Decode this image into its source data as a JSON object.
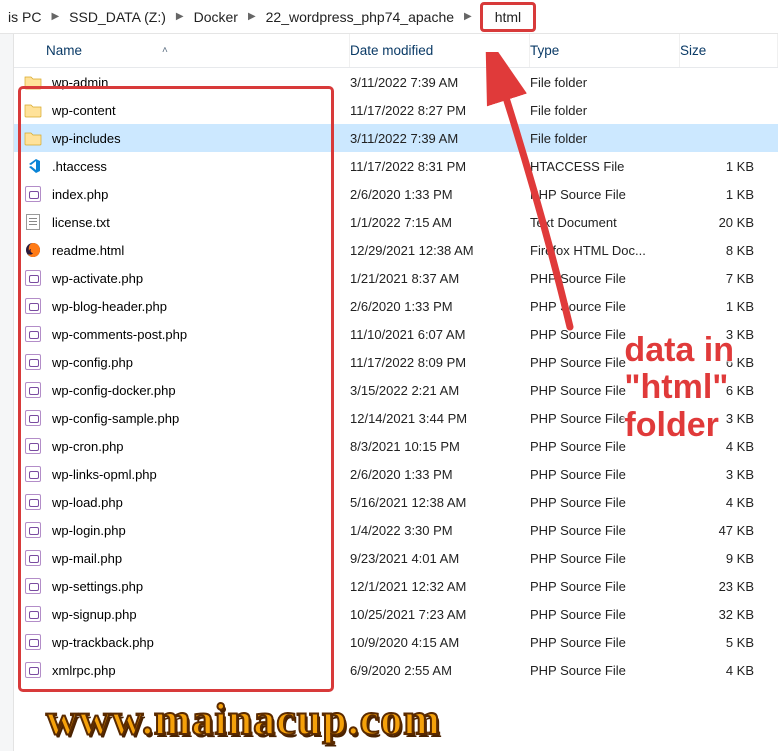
{
  "breadcrumb": {
    "items": [
      "is PC",
      "SSD_DATA (Z:)",
      "Docker",
      "22_wordpress_php74_apache",
      "html"
    ],
    "highlighted": "html"
  },
  "columns": {
    "name": "Name",
    "date": "Date modified",
    "type": "Type",
    "size": "Size"
  },
  "annotation": {
    "text": "data in\n\"html\"\nfolder"
  },
  "watermark": "www.mainacup.com",
  "files": [
    {
      "icon": "folder",
      "name": "wp-admin",
      "date": "3/11/2022 7:39 AM",
      "type": "File folder",
      "size": ""
    },
    {
      "icon": "folder",
      "name": "wp-content",
      "date": "11/17/2022 8:27 PM",
      "type": "File folder",
      "size": ""
    },
    {
      "icon": "folder",
      "name": "wp-includes",
      "date": "3/11/2022 7:39 AM",
      "type": "File folder",
      "size": "",
      "selected": true
    },
    {
      "icon": "vs",
      "name": ".htaccess",
      "date": "11/17/2022 8:31 PM",
      "type": "HTACCESS File",
      "size": "1 KB"
    },
    {
      "icon": "php",
      "name": "index.php",
      "date": "2/6/2020 1:33 PM",
      "type": "PHP Source File",
      "size": "1 KB"
    },
    {
      "icon": "txt",
      "name": "license.txt",
      "date": "1/1/2022 7:15 AM",
      "type": "Text Document",
      "size": "20 KB"
    },
    {
      "icon": "ff",
      "name": "readme.html",
      "date": "12/29/2021 12:38 AM",
      "type": "Firefox HTML Doc...",
      "size": "8 KB"
    },
    {
      "icon": "php",
      "name": "wp-activate.php",
      "date": "1/21/2021 8:37 AM",
      "type": "PHP Source File",
      "size": "7 KB"
    },
    {
      "icon": "php",
      "name": "wp-blog-header.php",
      "date": "2/6/2020 1:33 PM",
      "type": "PHP Source File",
      "size": "1 KB"
    },
    {
      "icon": "php",
      "name": "wp-comments-post.php",
      "date": "11/10/2021 6:07 AM",
      "type": "PHP Source File",
      "size": "3 KB"
    },
    {
      "icon": "php",
      "name": "wp-config.php",
      "date": "11/17/2022 8:09 PM",
      "type": "PHP Source File",
      "size": "6 KB"
    },
    {
      "icon": "php",
      "name": "wp-config-docker.php",
      "date": "3/15/2022 2:21 AM",
      "type": "PHP Source File",
      "size": "6 KB"
    },
    {
      "icon": "php",
      "name": "wp-config-sample.php",
      "date": "12/14/2021 3:44 PM",
      "type": "PHP Source File",
      "size": "3 KB"
    },
    {
      "icon": "php",
      "name": "wp-cron.php",
      "date": "8/3/2021 10:15 PM",
      "type": "PHP Source File",
      "size": "4 KB"
    },
    {
      "icon": "php",
      "name": "wp-links-opml.php",
      "date": "2/6/2020 1:33 PM",
      "type": "PHP Source File",
      "size": "3 KB"
    },
    {
      "icon": "php",
      "name": "wp-load.php",
      "date": "5/16/2021 12:38 AM",
      "type": "PHP Source File",
      "size": "4 KB"
    },
    {
      "icon": "php",
      "name": "wp-login.php",
      "date": "1/4/2022 3:30 PM",
      "type": "PHP Source File",
      "size": "47 KB"
    },
    {
      "icon": "php",
      "name": "wp-mail.php",
      "date": "9/23/2021 4:01 AM",
      "type": "PHP Source File",
      "size": "9 KB"
    },
    {
      "icon": "php",
      "name": "wp-settings.php",
      "date": "12/1/2021 12:32 AM",
      "type": "PHP Source File",
      "size": "23 KB"
    },
    {
      "icon": "php",
      "name": "wp-signup.php",
      "date": "10/25/2021 7:23 AM",
      "type": "PHP Source File",
      "size": "32 KB"
    },
    {
      "icon": "php",
      "name": "wp-trackback.php",
      "date": "10/9/2020 4:15 AM",
      "type": "PHP Source File",
      "size": "5 KB"
    },
    {
      "icon": "php",
      "name": "xmlrpc.php",
      "date": "6/9/2020 2:55 AM",
      "type": "PHP Source File",
      "size": "4 KB"
    }
  ]
}
